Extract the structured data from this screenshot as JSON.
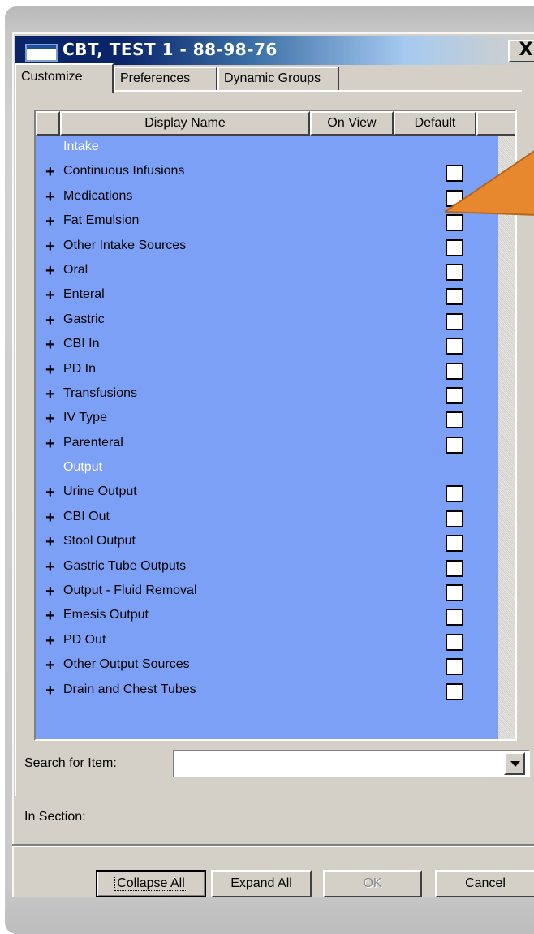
{
  "window": {
    "title": "CBT, TEST 1 - 88-98-76",
    "close_label": "X"
  },
  "tabs": [
    {
      "label": "Customize",
      "active": true
    },
    {
      "label": "Preferences",
      "active": false
    },
    {
      "label": "Dynamic Groups",
      "active": false
    }
  ],
  "grid": {
    "columns": [
      "",
      "Display Name",
      "On View",
      "Default"
    ],
    "rows": [
      {
        "type": "section",
        "label": "Intake"
      },
      {
        "type": "item",
        "label": "Continuous Infusions",
        "default_checked": false
      },
      {
        "type": "item",
        "label": "Medications",
        "default_checked": false
      },
      {
        "type": "item",
        "label": "Fat Emulsion",
        "default_checked": false
      },
      {
        "type": "item",
        "label": "Other Intake Sources",
        "default_checked": false
      },
      {
        "type": "item",
        "label": "Oral",
        "default_checked": false
      },
      {
        "type": "item",
        "label": "Enteral",
        "default_checked": false
      },
      {
        "type": "item",
        "label": "Gastric",
        "default_checked": false
      },
      {
        "type": "item",
        "label": "CBI In",
        "default_checked": false
      },
      {
        "type": "item",
        "label": "PD In",
        "default_checked": false
      },
      {
        "type": "item",
        "label": "Transfusions",
        "default_checked": false
      },
      {
        "type": "item",
        "label": "IV Type",
        "default_checked": false
      },
      {
        "type": "item",
        "label": "Parenteral",
        "default_checked": false
      },
      {
        "type": "section",
        "label": "Output"
      },
      {
        "type": "item",
        "label": "Urine Output",
        "default_checked": false
      },
      {
        "type": "item",
        "label": "CBI Out",
        "default_checked": false
      },
      {
        "type": "item",
        "label": "Stool Output",
        "default_checked": false
      },
      {
        "type": "item",
        "label": "Gastric Tube Outputs",
        "default_checked": false
      },
      {
        "type": "item",
        "label": "Output - Fluid Removal",
        "default_checked": false
      },
      {
        "type": "item",
        "label": "Emesis Output",
        "default_checked": false
      },
      {
        "type": "item",
        "label": "PD Out",
        "default_checked": false
      },
      {
        "type": "item",
        "label": "Other Output Sources",
        "default_checked": false
      },
      {
        "type": "item",
        "label": "Drain and Chest Tubes",
        "default_checked": false
      }
    ],
    "expand_symbol": "+"
  },
  "search": {
    "label": "Search for Item:",
    "value": ""
  },
  "in_section": {
    "label": "In Section:"
  },
  "buttons": {
    "collapse_all": "Collapse All",
    "expand_all": "Expand All",
    "ok": "OK",
    "cancel": "Cancel"
  },
  "colors": {
    "grid_background": "#7da0f7",
    "callout_arrow": "#e8882e",
    "titlebar_start": "#0a246a"
  }
}
